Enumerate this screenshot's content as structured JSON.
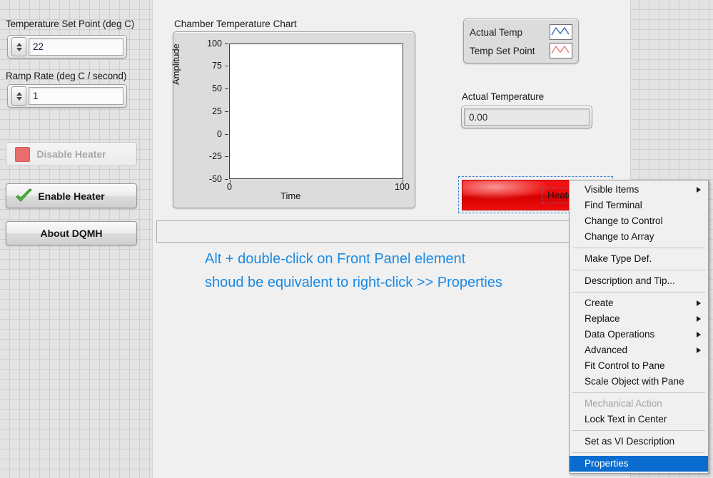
{
  "controls": {
    "setpoint": {
      "label": "Temperature Set Point (deg C)",
      "value": "22"
    },
    "ramp_rate": {
      "label": "Ramp Rate (deg C / second)",
      "value": "1"
    }
  },
  "buttons": {
    "disable_heater": "Disable Heater",
    "enable_heater": "Enable Heater",
    "about": "About DQMH"
  },
  "chart": {
    "title": "Chamber Temperature Chart",
    "legend": [
      {
        "name": "Actual Temp",
        "color": "#4a7ebb"
      },
      {
        "name": "Temp Set Point",
        "color": "#e88b8b"
      }
    ]
  },
  "chart_data": {
    "type": "line",
    "title": "Chamber Temperature Chart",
    "xlabel": "Time",
    "ylabel": "Amplitude",
    "xlim": [
      0,
      100
    ],
    "ylim": [
      -50,
      100
    ],
    "xticks": [
      "0",
      "100"
    ],
    "yticks": [
      "100",
      "75",
      "50",
      "25",
      "0",
      "-25",
      "-50"
    ],
    "grid": false,
    "legend_position": "top-right-external",
    "series": [
      {
        "name": "Actual Temp",
        "color": "#4a7ebb",
        "x": [],
        "y": []
      },
      {
        "name": "Temp Set Point",
        "color": "#e88b8b",
        "x": [],
        "y": []
      }
    ]
  },
  "indicator": {
    "label": "Actual Temperature",
    "value": "0.00"
  },
  "heater": {
    "label": "Heater OFF"
  },
  "annotation": {
    "line1": "Alt + double-click on Front Panel element",
    "line2": "shoud be equivalent to right-click >> Properties",
    "color": "#1a8ae5"
  },
  "context_menu": {
    "items": [
      {
        "label": "Visible Items",
        "submenu": true,
        "disabled": false,
        "highlight": false
      },
      {
        "label": "Find Terminal",
        "submenu": false,
        "disabled": false,
        "highlight": false
      },
      {
        "label": "Change to Control",
        "submenu": false,
        "disabled": false,
        "highlight": false
      },
      {
        "label": "Change to Array",
        "submenu": false,
        "disabled": false,
        "highlight": false
      },
      {
        "separator": true
      },
      {
        "label": "Make Type Def.",
        "submenu": false,
        "disabled": false,
        "highlight": false
      },
      {
        "separator": true
      },
      {
        "label": "Description and Tip...",
        "submenu": false,
        "disabled": false,
        "highlight": false
      },
      {
        "separator": true
      },
      {
        "label": "Create",
        "submenu": true,
        "disabled": false,
        "highlight": false
      },
      {
        "label": "Replace",
        "submenu": true,
        "disabled": false,
        "highlight": false
      },
      {
        "label": "Data Operations",
        "submenu": true,
        "disabled": false,
        "highlight": false
      },
      {
        "label": "Advanced",
        "submenu": true,
        "disabled": false,
        "highlight": false
      },
      {
        "label": "Fit Control to Pane",
        "submenu": false,
        "disabled": false,
        "highlight": false
      },
      {
        "label": "Scale Object with Pane",
        "submenu": false,
        "disabled": false,
        "highlight": false
      },
      {
        "separator": true
      },
      {
        "label": "Mechanical Action",
        "submenu": false,
        "disabled": true,
        "highlight": false
      },
      {
        "label": "Lock Text in Center",
        "submenu": false,
        "disabled": false,
        "highlight": false
      },
      {
        "separator": true
      },
      {
        "label": "Set as VI Description",
        "submenu": false,
        "disabled": false,
        "highlight": false
      },
      {
        "separator": true
      },
      {
        "label": "Properties",
        "submenu": false,
        "disabled": false,
        "highlight": true
      }
    ]
  }
}
